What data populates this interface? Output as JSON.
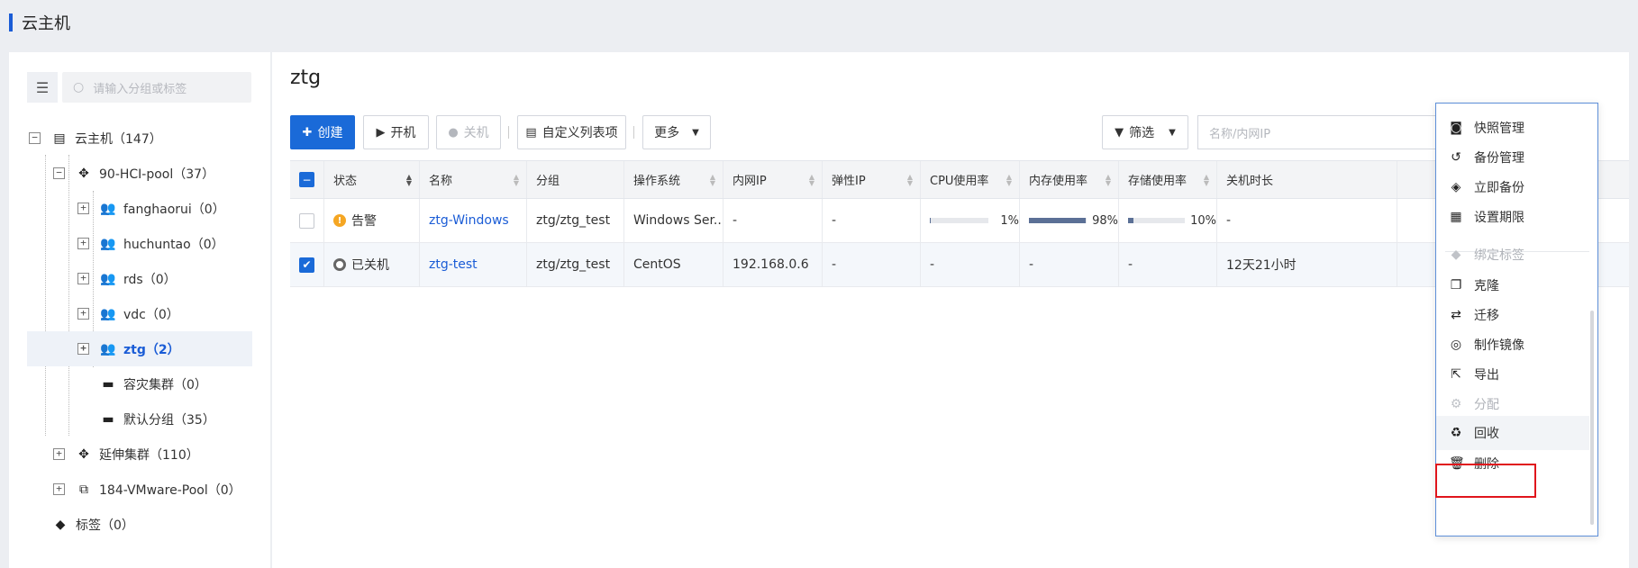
{
  "page_title": "云主机",
  "search": {
    "placeholder": "请输入分组或标签"
  },
  "tree": [
    {
      "label": "云主机（147）",
      "icon": "server-icon"
    },
    {
      "label": "90-HCI-pool（37）",
      "icon": "cluster-icon"
    },
    {
      "label": "fanghaorui（0）",
      "icon": "user-icon"
    },
    {
      "label": "huchuntao（0）",
      "icon": "user-icon"
    },
    {
      "label": "rds（0）",
      "icon": "user-icon"
    },
    {
      "label": "vdc（0）",
      "icon": "user-icon"
    },
    {
      "label": "ztg（2）",
      "icon": "user-icon",
      "selected": true
    },
    {
      "label": "容灾集群（0）",
      "icon": "folder-icon"
    },
    {
      "label": "默认分组（35）",
      "icon": "folder-icon"
    },
    {
      "label": "延伸集群（110）",
      "icon": "cluster-icon"
    },
    {
      "label": "184-VMware-Pool（0）",
      "icon": "vmware-icon"
    },
    {
      "label": "标签（0）",
      "icon": "tag-icon"
    }
  ],
  "main": {
    "title": "ztg"
  },
  "toolbar": {
    "create": "创建",
    "power_on": "开机",
    "power_off": "关机",
    "custom_columns": "自定义列表项",
    "more": "更多",
    "filter": "筛选",
    "filter_placeholder": "名称/内网IP"
  },
  "table": {
    "columns": [
      "状态",
      "名称",
      "分组",
      "操作系统",
      "内网IP",
      "弹性IP",
      "CPU使用率",
      "内存使用率",
      "存储使用率",
      "关机时长"
    ],
    "rows": [
      {
        "checked": false,
        "status": "告警",
        "name": "ztg-Windows",
        "group": "ztg/ztg_test",
        "os": "Windows Ser...",
        "ip": "-",
        "eip": "-",
        "cpu": "1%",
        "cpu_value": 0.01,
        "mem": "98%",
        "mem_value": 0.98,
        "disk": "10%",
        "disk_value": 0.1,
        "off_time": "-"
      },
      {
        "checked": true,
        "status": "已关机",
        "name": "ztg-test",
        "group": "ztg/ztg_test",
        "os": "CentOS",
        "ip": "192.168.0.6",
        "eip": "-",
        "cpu": "-",
        "mem": "-",
        "disk": "-",
        "off_time": "12天21小时"
      }
    ]
  },
  "menu": [
    {
      "label": "快照管理",
      "icon": "snapshot-icon",
      "enabled": true
    },
    {
      "label": "备份管理",
      "icon": "history-icon",
      "enabled": true
    },
    {
      "label": "立即备份",
      "icon": "layers-icon",
      "enabled": true
    },
    {
      "label": "设置期限",
      "icon": "calendar-icon",
      "enabled": true
    },
    {
      "label": "绑定标签",
      "icon": "tag-icon",
      "enabled": false
    },
    {
      "label": "克隆",
      "icon": "clone-icon",
      "enabled": true
    },
    {
      "label": "迁移",
      "icon": "migrate-icon",
      "enabled": true
    },
    {
      "label": "制作镜像",
      "icon": "disc-icon",
      "enabled": true
    },
    {
      "label": "导出",
      "icon": "export-icon",
      "enabled": true
    },
    {
      "label": "分配",
      "icon": "gear-icon",
      "enabled": false
    },
    {
      "label": "回收",
      "icon": "recycle-icon",
      "enabled": true,
      "highlighted": true
    },
    {
      "label": "删除",
      "icon": "trash-icon",
      "enabled": true
    }
  ]
}
